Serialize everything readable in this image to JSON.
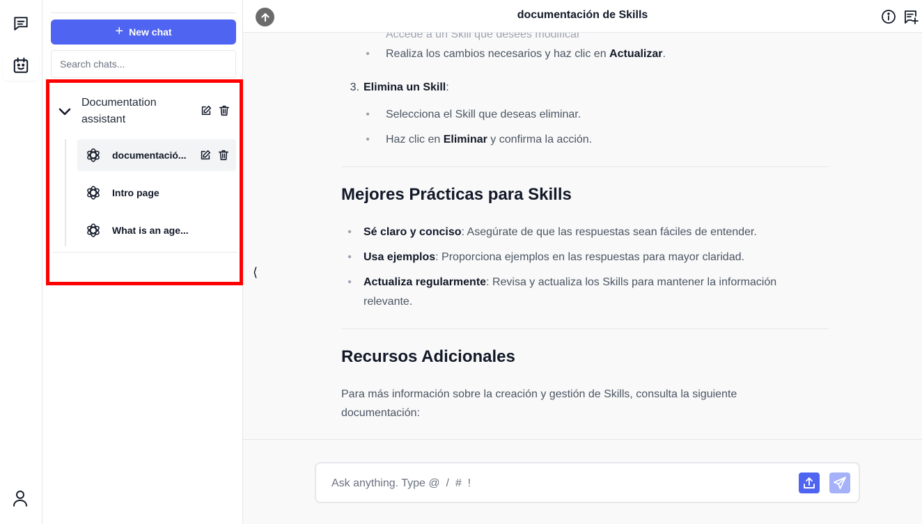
{
  "rail": {
    "items": [
      {
        "icon": "chat-bubble-icon"
      },
      {
        "icon": "bot-calendar-icon"
      }
    ],
    "user_icon": "user-icon"
  },
  "sidebar": {
    "new_chat_label": "New chat",
    "search_placeholder": "Search chats...",
    "group": {
      "title": "Documentation assistant",
      "chats": [
        {
          "label": "documentació...",
          "active": true
        },
        {
          "label": "Intro page",
          "active": false
        },
        {
          "label": "What is an age...",
          "active": false
        }
      ]
    }
  },
  "header": {
    "title": "documentación de Skills"
  },
  "content": {
    "cut_line": "Accede a un Skill que desees modificar",
    "update_bullet": {
      "pre": "Realiza los cambios necesarios y haz clic en ",
      "bold": "Actualizar",
      "post": "."
    },
    "step3": {
      "num": "3.",
      "bold": "Elimina un Skill",
      "post": ":"
    },
    "step3_bullets": [
      {
        "pre": "Selecciona el Skill que deseas eliminar.",
        "bold": "",
        "post": ""
      },
      {
        "pre": "Haz clic en ",
        "bold": "Eliminar",
        "post": " y confirma la acción."
      }
    ],
    "best_practices_heading": "Mejores Prácticas para Skills",
    "best_practices": [
      {
        "bold": "Sé claro y conciso",
        "text": ": Asegúrate de que las respuestas sean fáciles de entender."
      },
      {
        "bold": "Usa ejemplos",
        "text": ": Proporciona ejemplos en las respuestas para mayor claridad."
      },
      {
        "bold": "Actualiza regularmente",
        "text": ": Revisa y actualiza los Skills para mantener la información relevante."
      }
    ],
    "resources_heading": "Recursos Adicionales",
    "resources_paragraph": "Para más información sobre la creación y gestión de Skills, consulta la siguiente documentación:"
  },
  "composer": {
    "placeholder": "Ask anything. Type @  /  #  !"
  },
  "colors": {
    "accent": "#4f64f0",
    "accent_light": "#a5b1f8",
    "highlight": "#ff0000"
  }
}
